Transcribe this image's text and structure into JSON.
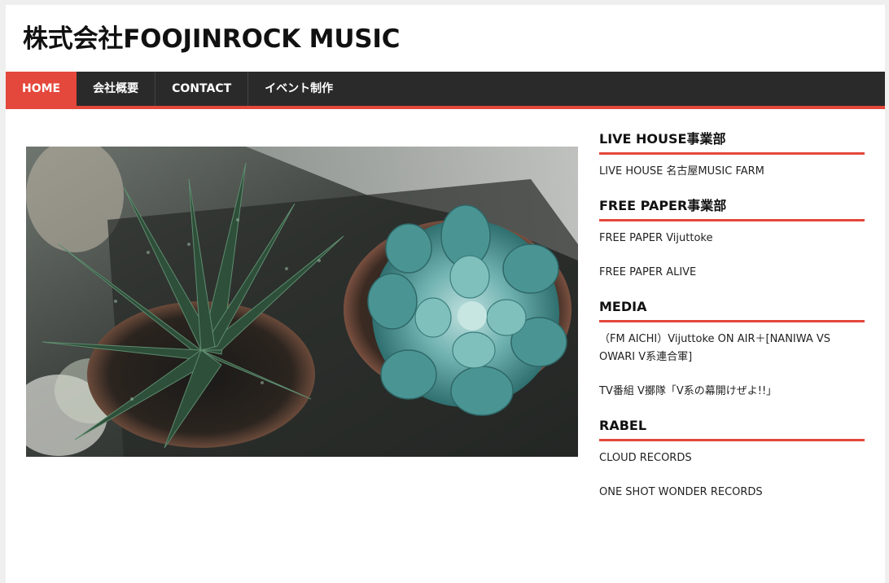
{
  "site": {
    "title": "株式会社FOOJINROCK MUSIC"
  },
  "nav": {
    "items": [
      {
        "label": "HOME"
      },
      {
        "label": "会社概要"
      },
      {
        "label": "CONTACT"
      },
      {
        "label": "イベント制作"
      }
    ]
  },
  "hero": {
    "icon": "succulent-photo"
  },
  "sidebar": {
    "widgets": [
      {
        "title": "LIVE HOUSE事業部",
        "links": [
          "LIVE HOUSE 名古屋MUSIC FARM"
        ]
      },
      {
        "title": "FREE PAPER事業部",
        "links": [
          "FREE PAPER Vijuttoke",
          "FREE PAPER ALIVE"
        ]
      },
      {
        "title": "MEDIA",
        "links": [
          "（FM AICHI）Vijuttoke ON AIR＋[NANIWA VS OWARI V系連合軍]",
          "TV番組 V擲隊「V系の幕開けぜよ!!」"
        ]
      },
      {
        "title": "RABEL",
        "links": [
          "CLOUD RECORDS",
          "ONE SHOT WONDER RECORDS"
        ]
      }
    ]
  },
  "colors": {
    "accent": "#e4473b",
    "nav_bg": "#2a2a2a"
  }
}
